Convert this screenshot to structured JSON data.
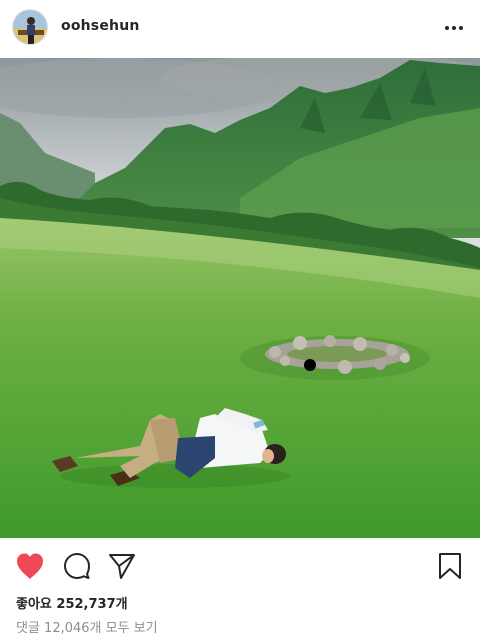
{
  "post": {
    "username": "oohsehun",
    "likes_text": "좋아요 252,737개",
    "comments_text": "댓글 12,046개 모두 보기"
  },
  "icons": {
    "more": "more-horizontal-icon",
    "like": "heart-icon",
    "comment": "comment-bubble-icon",
    "share": "send-paper-plane-icon",
    "save": "bookmark-icon"
  },
  "colors": {
    "like_active": "#ed4956",
    "text": "#262626",
    "secondary_text": "#8e8e8e"
  },
  "state": {
    "liked": true,
    "saved": false
  }
}
